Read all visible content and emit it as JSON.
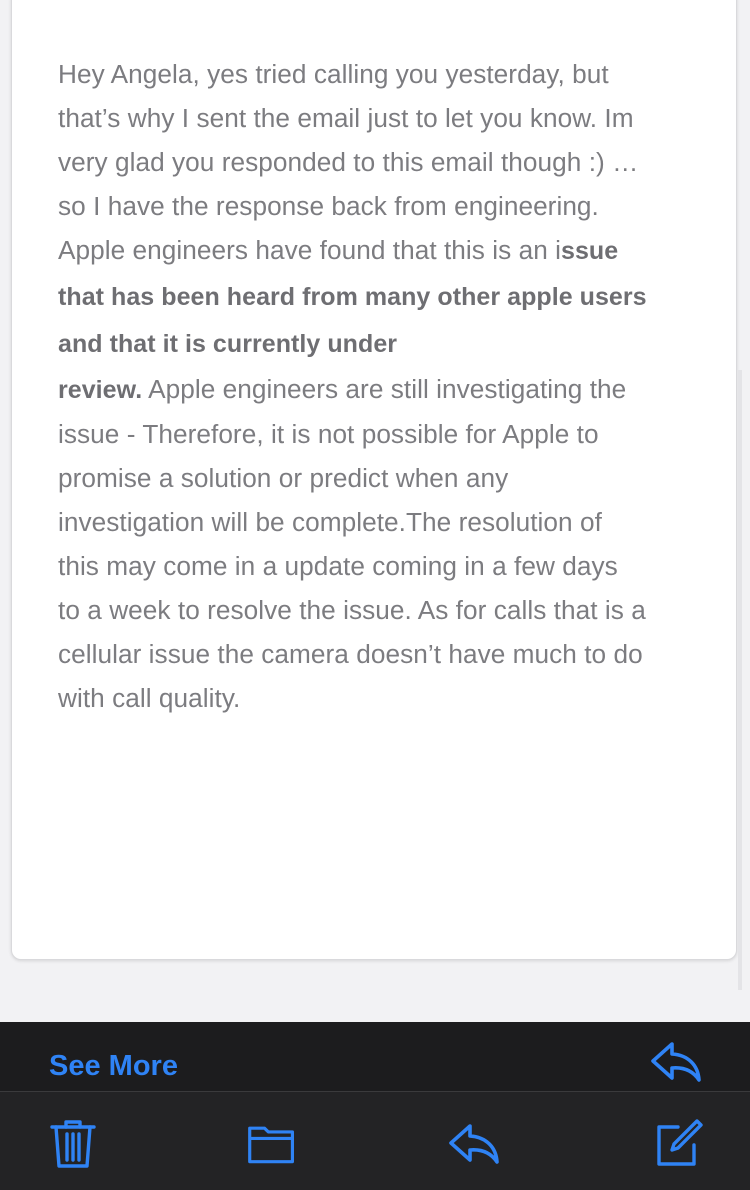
{
  "email": {
    "body_lines": [
      {
        "text": "Hey Angela, yes tried calling you yesterday, but"
      },
      {
        "text": "that’s why I sent the email just to let you know. Im"
      },
      {
        "text": "very glad you responded to this email though :) …"
      },
      {
        "text": "so I have the response back from engineering."
      },
      {
        "pre": "Apple engineers have found that this is an i",
        "bold": "ssue"
      },
      {
        "bold": "that has been heard from many other apple users"
      },
      {
        "bold": "and that it is currently under"
      },
      {
        "bold": "review.",
        "post": " Apple engineers are still investigating the"
      },
      {
        "text": "issue - Therefore, it is not possible for Apple to"
      },
      {
        "text": "promise a solution or predict when any"
      },
      {
        "text": "investigation will be complete.The resolution of"
      },
      {
        "text": "this may come in a update coming in a few days"
      },
      {
        "text": "to a week to resolve the issue. As for calls that is a"
      },
      {
        "text": "cellular issue the camera doesn’t have much to do"
      },
      {
        "text": "with call quality."
      }
    ]
  },
  "footer": {
    "see_more_label": "See More"
  },
  "toolbar": {
    "icons": [
      "trash-icon",
      "folder-icon",
      "reply-icon",
      "compose-icon"
    ]
  },
  "colors": {
    "accent": "#2f83f5",
    "body_text": "#7c7c80",
    "toolbar_bg": "#232325"
  }
}
